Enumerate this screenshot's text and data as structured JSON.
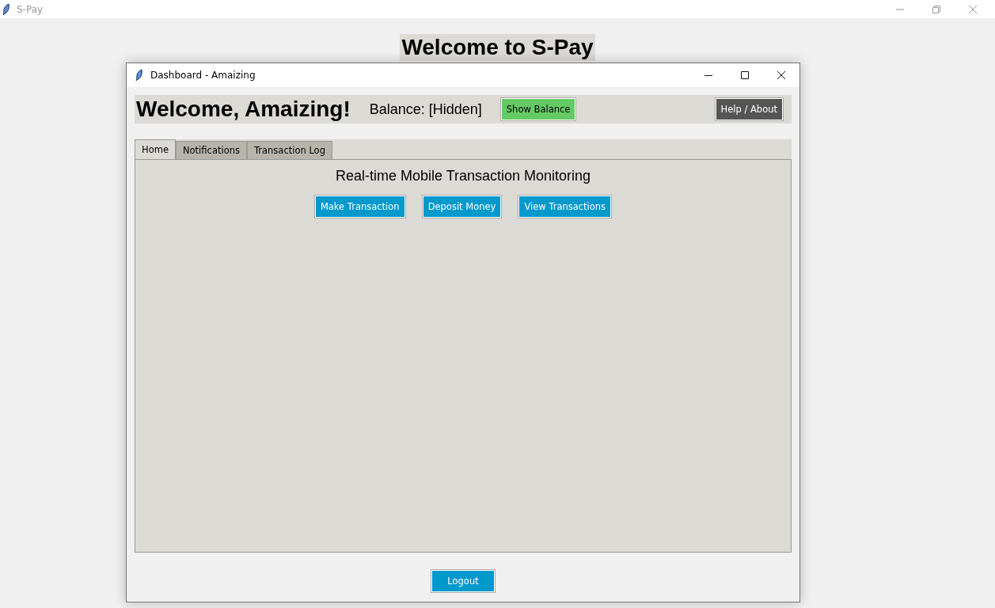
{
  "main_window": {
    "title": "S-Pay",
    "heading": "Welcome to S-Pay"
  },
  "dialog": {
    "title": "Dashboard - Amaizing"
  },
  "header": {
    "welcome": "Welcome, Amaizing!",
    "balance": "Balance: [Hidden]",
    "show_balance_button": "Show Balance",
    "help_button": "Help / About"
  },
  "tabs": [
    {
      "label": "Home",
      "selected": true
    },
    {
      "label": "Notifications",
      "selected": false
    },
    {
      "label": "Transaction Log",
      "selected": false
    }
  ],
  "home": {
    "heading": "Real-time Mobile Transaction Monitoring",
    "actions": [
      "Make Transaction",
      "Deposit Money",
      "View Transactions"
    ]
  },
  "logout_button": "Logout"
}
